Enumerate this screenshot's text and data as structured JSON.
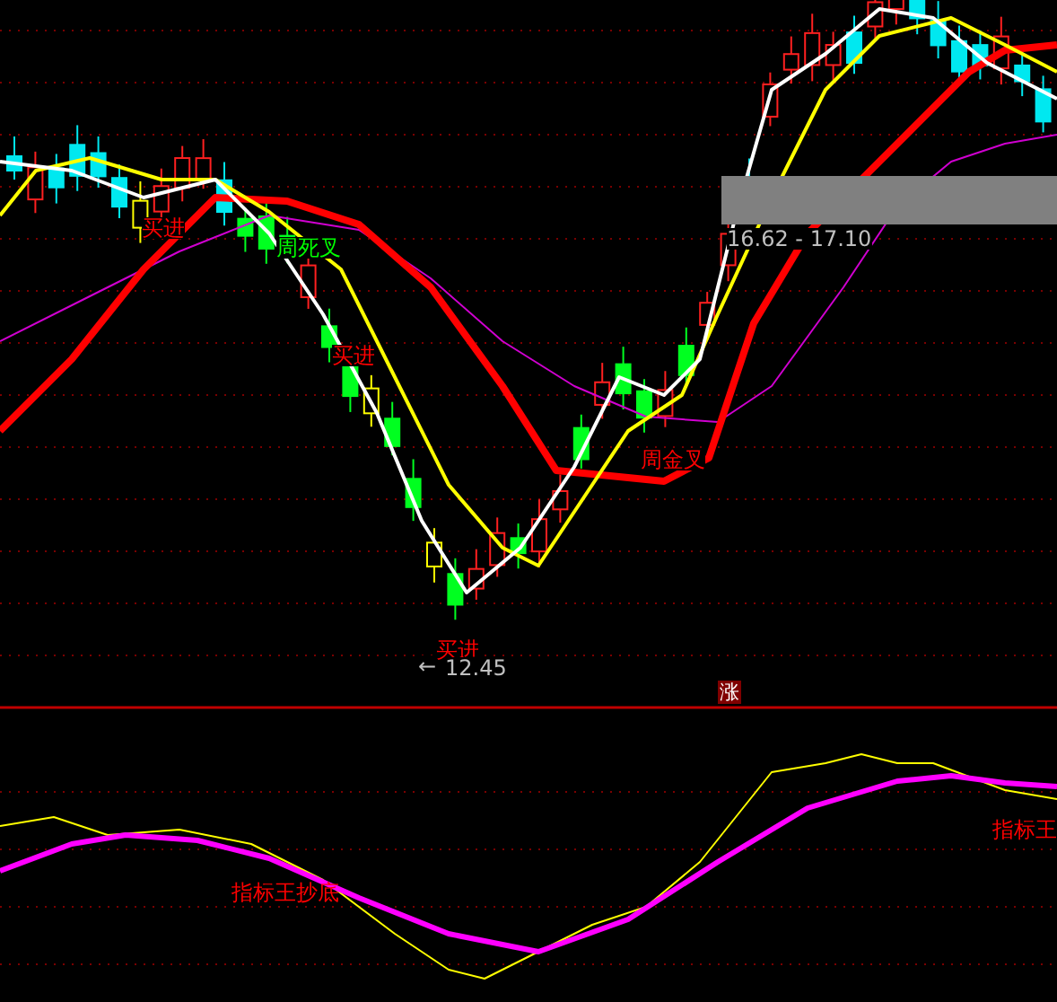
{
  "main_chart": {
    "signals": [
      {
        "text": "买进",
        "color": "#ff0000"
      },
      {
        "text": "周死叉",
        "color": "#00ff00"
      },
      {
        "text": "买进",
        "color": "#ff0000"
      },
      {
        "text": "周金叉",
        "color": "#ff0000"
      },
      {
        "text": "买进",
        "color": "#ff0000"
      }
    ],
    "low_marker": {
      "arrow": "←",
      "value": "12.45"
    },
    "price_range": "16.62 - 17.10",
    "badge": "涨"
  },
  "indicator_chart": {
    "labels": [
      {
        "text": "指标王抄底"
      },
      {
        "text": "指标王"
      }
    ]
  }
}
